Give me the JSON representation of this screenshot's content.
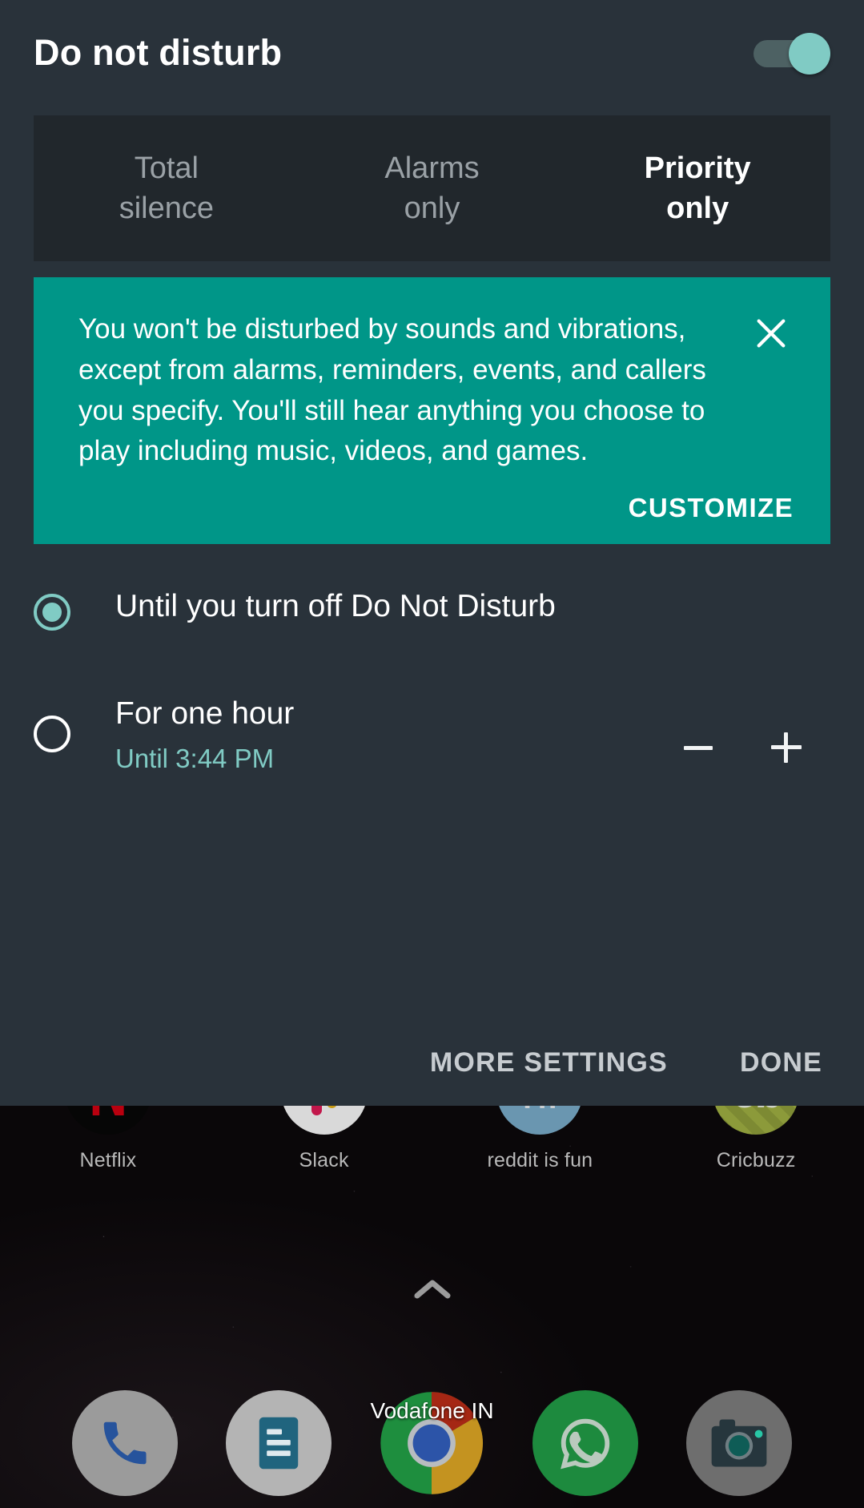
{
  "dnd": {
    "title": "Do not disturb",
    "toggle_on": true,
    "modes": [
      {
        "label": "Total\nsilence",
        "line1": "Total",
        "line2": "silence",
        "selected": false
      },
      {
        "label": "Alarms\nonly",
        "line1": "Alarms",
        "line2": "only",
        "selected": false
      },
      {
        "label": "Priority\nonly",
        "line1": "Priority",
        "line2": "only",
        "selected": true
      }
    ],
    "info_card": {
      "text": "You won't be disturbed by sounds and vibrations, except from alarms, reminders, events, and callers you specify. You'll still hear anything you choose to play including music, videos, and games.",
      "customize_label": "CUSTOMIZE",
      "close_icon": "close-icon",
      "background_color": "#009688"
    },
    "duration_options": [
      {
        "title": "Until you turn off Do Not Disturb",
        "subtitle": "",
        "selected": true,
        "has_stepper": false
      },
      {
        "title": "For one hour",
        "subtitle": "Until 3:44 PM",
        "selected": false,
        "has_stepper": true,
        "decrement_label": "−",
        "increment_label": "+"
      }
    ],
    "actions": {
      "more_settings_label": "MORE SETTINGS",
      "done_label": "DONE"
    },
    "accent_color": "#80cbc4",
    "panel_background": "#29323a"
  },
  "home": {
    "apps": [
      {
        "label": "Netflix",
        "icon": "netflix-icon"
      },
      {
        "label": "Slack",
        "icon": "slack-icon"
      },
      {
        "label": "reddit is fun",
        "icon": "reddit-is-fun-icon"
      },
      {
        "label": "Cricbuzz",
        "icon": "cricbuzz-icon"
      }
    ],
    "drawer_arrow_icon": "chevron-up-icon",
    "carrier": "Vodafone IN",
    "dock": [
      {
        "label": "Phone",
        "icon": "phone-icon"
      },
      {
        "label": "Messages",
        "icon": "messages-icon"
      },
      {
        "label": "Chrome",
        "icon": "chrome-icon"
      },
      {
        "label": "WhatsApp",
        "icon": "whatsapp-icon"
      },
      {
        "label": "Camera",
        "icon": "camera-icon"
      }
    ]
  }
}
